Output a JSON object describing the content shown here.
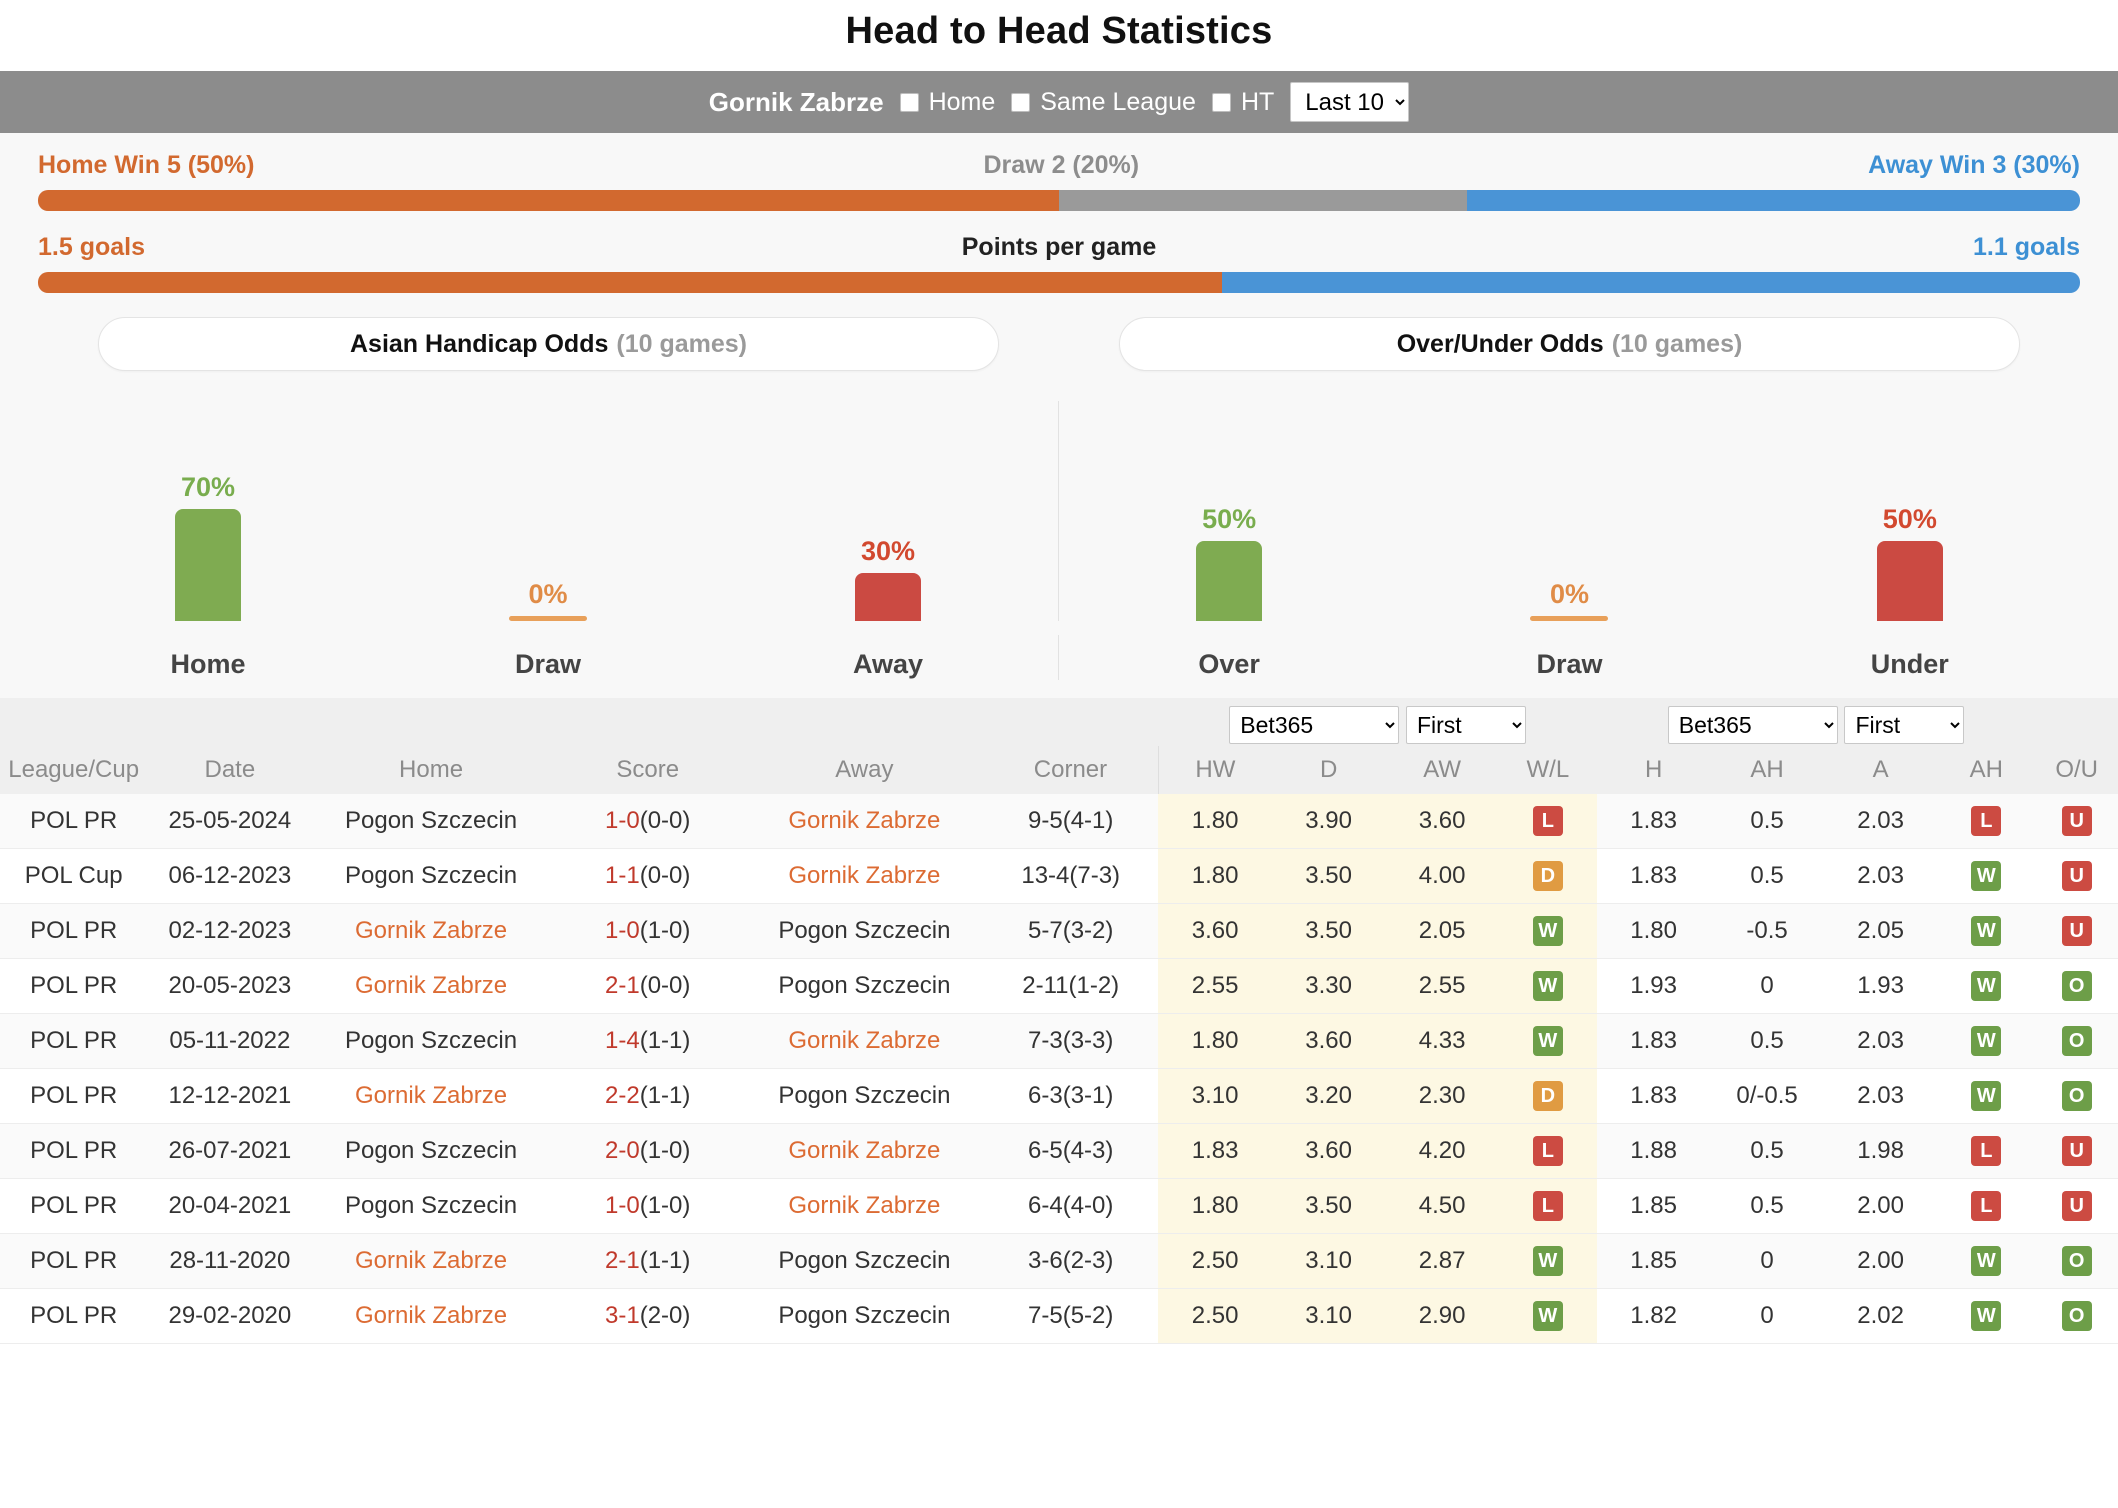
{
  "page_title": "Head to Head Statistics",
  "filterbar": {
    "team": "Gornik Zabrze",
    "checkboxes": [
      {
        "label": "Home",
        "checked": false
      },
      {
        "label": "Same League",
        "checked": false
      },
      {
        "label": "HT",
        "checked": false
      }
    ],
    "range_select": {
      "value": "Last 10",
      "options": [
        "Last 10"
      ]
    }
  },
  "summary": {
    "home_win": "Home Win 5 (50%)",
    "draw": "Draw 2 (20%)",
    "away_win": "Away Win 3 (30%)",
    "home_pct": 50,
    "draw_pct": 20,
    "away_pct": 30,
    "goals_home": "1.5 goals",
    "goals_title": "Points per game",
    "goals_away": "1.1 goals",
    "goals_home_pct": 58,
    "goals_away_pct": 42
  },
  "panels": {
    "asian": {
      "title": "Asian Handicap Odds",
      "games": "(10 games)"
    },
    "overunder": {
      "title": "Over/Under Odds",
      "games": "(10 games)"
    }
  },
  "chart_data": [
    {
      "type": "bar",
      "title": "Asian Handicap Odds (10 games)",
      "categories": [
        "Home",
        "Draw",
        "Away"
      ],
      "values": [
        70,
        0,
        30
      ],
      "labels": [
        "70%",
        "0%",
        "30%"
      ],
      "colors": [
        "#7fab51",
        "#e8a05a",
        "#cb4a42"
      ],
      "ylim": [
        0,
        100
      ],
      "ylabel": "",
      "xlabel": "",
      "grid": false,
      "legend": "none"
    },
    {
      "type": "bar",
      "title": "Over/Under Odds (10 games)",
      "categories": [
        "Over",
        "Draw",
        "Under"
      ],
      "values": [
        50,
        0,
        50
      ],
      "labels": [
        "50%",
        "0%",
        "50%"
      ],
      "colors": [
        "#7fab51",
        "#e8a05a",
        "#cb4a42"
      ],
      "ylim": [
        0,
        100
      ],
      "ylabel": "",
      "xlabel": "",
      "grid": false,
      "legend": "none"
    }
  ],
  "table": {
    "left_headers": [
      "League/Cup",
      "Date",
      "Home",
      "Score",
      "Away",
      "Corner"
    ],
    "odds_selects": [
      {
        "name": "book1",
        "value": "Bet365"
      },
      {
        "name": "time1",
        "value": "First"
      },
      {
        "name": "book2",
        "value": "Bet365"
      },
      {
        "name": "time2",
        "value": "First"
      }
    ],
    "odds_headers_1x2": [
      "HW",
      "D",
      "AW",
      "W/L"
    ],
    "odds_headers_ah": [
      "H",
      "AH",
      "A",
      "AH"
    ],
    "ou_header": "O/U",
    "rows": [
      {
        "league": "POL PR",
        "date": "25-05-2024",
        "home": "Pogon Szczecin",
        "home_hl": false,
        "score": "1-0",
        "ht": "(0-0)",
        "away": "Gornik Zabrze",
        "away_hl": true,
        "corner": "9-5(4-1)",
        "hw": "1.80",
        "d": "3.90",
        "aw": "3.60",
        "wl": "L",
        "h": "1.83",
        "ah": "0.5",
        "a": "2.03",
        "ah2": "L",
        "ou": "U"
      },
      {
        "league": "POL Cup",
        "date": "06-12-2023",
        "home": "Pogon Szczecin",
        "home_hl": false,
        "score": "1-1",
        "ht": "(0-0)",
        "away": "Gornik Zabrze",
        "away_hl": true,
        "corner": "13-4(7-3)",
        "hw": "1.80",
        "d": "3.50",
        "aw": "4.00",
        "wl": "D",
        "h": "1.83",
        "ah": "0.5",
        "a": "2.03",
        "ah2": "W",
        "ou": "U"
      },
      {
        "league": "POL PR",
        "date": "02-12-2023",
        "home": "Gornik Zabrze",
        "home_hl": true,
        "score": "1-0",
        "ht": "(1-0)",
        "away": "Pogon Szczecin",
        "away_hl": false,
        "corner": "5-7(3-2)",
        "hw": "3.60",
        "d": "3.50",
        "aw": "2.05",
        "wl": "W",
        "h": "1.80",
        "ah": "-0.5",
        "a": "2.05",
        "ah2": "W",
        "ou": "U"
      },
      {
        "league": "POL PR",
        "date": "20-05-2023",
        "home": "Gornik Zabrze",
        "home_hl": true,
        "score": "2-1",
        "ht": "(0-0)",
        "away": "Pogon Szczecin",
        "away_hl": false,
        "corner": "2-11(1-2)",
        "hw": "2.55",
        "d": "3.30",
        "aw": "2.55",
        "wl": "W",
        "h": "1.93",
        "ah": "0",
        "a": "1.93",
        "ah2": "W",
        "ou": "O"
      },
      {
        "league": "POL PR",
        "date": "05-11-2022",
        "home": "Pogon Szczecin",
        "home_hl": false,
        "score": "1-4",
        "ht": "(1-1)",
        "away": "Gornik Zabrze",
        "away_hl": true,
        "corner": "7-3(3-3)",
        "hw": "1.80",
        "d": "3.60",
        "aw": "4.33",
        "wl": "W",
        "h": "1.83",
        "ah": "0.5",
        "a": "2.03",
        "ah2": "W",
        "ou": "O"
      },
      {
        "league": "POL PR",
        "date": "12-12-2021",
        "home": "Gornik Zabrze",
        "home_hl": true,
        "score": "2-2",
        "ht": "(1-1)",
        "away": "Pogon Szczecin",
        "away_hl": false,
        "corner": "6-3(3-1)",
        "hw": "3.10",
        "d": "3.20",
        "aw": "2.30",
        "wl": "D",
        "h": "1.83",
        "ah": "0/-0.5",
        "a": "2.03",
        "ah2": "W",
        "ou": "O"
      },
      {
        "league": "POL PR",
        "date": "26-07-2021",
        "home": "Pogon Szczecin",
        "home_hl": false,
        "score": "2-0",
        "ht": "(1-0)",
        "away": "Gornik Zabrze",
        "away_hl": true,
        "corner": "6-5(4-3)",
        "hw": "1.83",
        "d": "3.60",
        "aw": "4.20",
        "wl": "L",
        "h": "1.88",
        "ah": "0.5",
        "a": "1.98",
        "ah2": "L",
        "ou": "U"
      },
      {
        "league": "POL PR",
        "date": "20-04-2021",
        "home": "Pogon Szczecin",
        "home_hl": false,
        "score": "1-0",
        "ht": "(1-0)",
        "away": "Gornik Zabrze",
        "away_hl": true,
        "corner": "6-4(4-0)",
        "hw": "1.80",
        "d": "3.50",
        "aw": "4.50",
        "wl": "L",
        "h": "1.85",
        "ah": "0.5",
        "a": "2.00",
        "ah2": "L",
        "ou": "U"
      },
      {
        "league": "POL PR",
        "date": "28-11-2020",
        "home": "Gornik Zabrze",
        "home_hl": true,
        "score": "2-1",
        "ht": "(1-1)",
        "away": "Pogon Szczecin",
        "away_hl": false,
        "corner": "3-6(2-3)",
        "hw": "2.50",
        "d": "3.10",
        "aw": "2.87",
        "wl": "W",
        "h": "1.85",
        "ah": "0",
        "a": "2.00",
        "ah2": "W",
        "ou": "O"
      },
      {
        "league": "POL PR",
        "date": "29-02-2020",
        "home": "Gornik Zabrze",
        "home_hl": true,
        "score": "3-1",
        "ht": "(2-0)",
        "away": "Pogon Szczecin",
        "away_hl": false,
        "corner": "7-5(5-2)",
        "hw": "2.50",
        "d": "3.10",
        "aw": "2.90",
        "wl": "W",
        "h": "1.82",
        "ah": "0",
        "a": "2.02",
        "ah2": "W",
        "ou": "O"
      }
    ]
  },
  "colors": {
    "orange": "#d2692f",
    "grey": "#9a9a9a",
    "blue": "#4a94d6",
    "green": "#7fab51",
    "red": "#cb4a42",
    "amber": "#e8a05a"
  }
}
